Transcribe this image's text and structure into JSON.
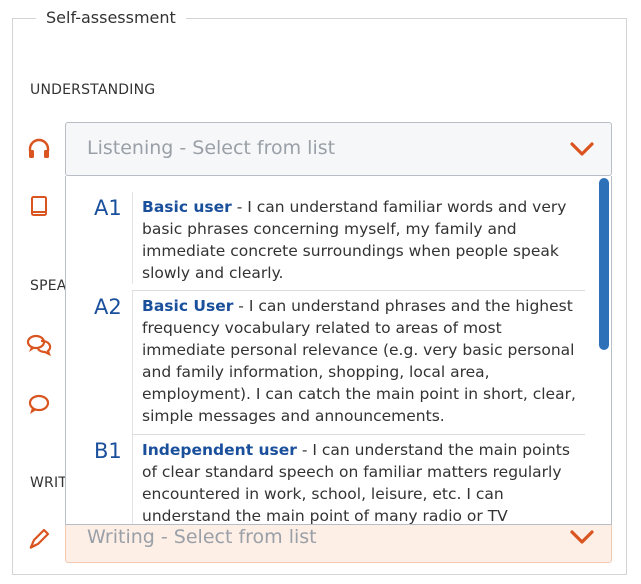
{
  "fieldset": {
    "legend": "Self-assessment"
  },
  "sections": {
    "understanding": "UNDERSTANDING",
    "speaking": "SPEA",
    "writing": "WRIT"
  },
  "listening_select": {
    "placeholder": "Listening - Select from list"
  },
  "writing_select": {
    "placeholder": "Writing - Select from list"
  },
  "options": [
    {
      "level": "A1",
      "title": "Basic user",
      "text": " - I can understand familiar words and very basic phrases concerning myself, my family and immediate concrete surroundings when people speak slowly and clearly."
    },
    {
      "level": "A2",
      "title": "Basic User",
      "text": " - I can understand phrases and the highest frequency vocabulary related to areas of most immediate personal relevance (e.g. very basic personal and family information, shopping, local area, employment). I can catch the main point in short, clear, simple messages and announcements."
    },
    {
      "level": "B1",
      "title": "Independent user",
      "text": " - I can understand the main points of clear standard speech on familiar matters regularly encountered in work, school, leisure, etc. I can understand the main point of many radio or TV programmes on"
    }
  ],
  "icons": {
    "listening": "headphones-icon",
    "reading": "book-icon",
    "spoken_interaction": "chat-bubbles-icon",
    "spoken_production": "chat-bubble-icon",
    "writing": "pen-icon",
    "chevron": "chevron-down-icon"
  },
  "colors": {
    "accent": "#d9541e",
    "link": "#1a4f9c",
    "scroll_thumb": "#2d72b8"
  }
}
